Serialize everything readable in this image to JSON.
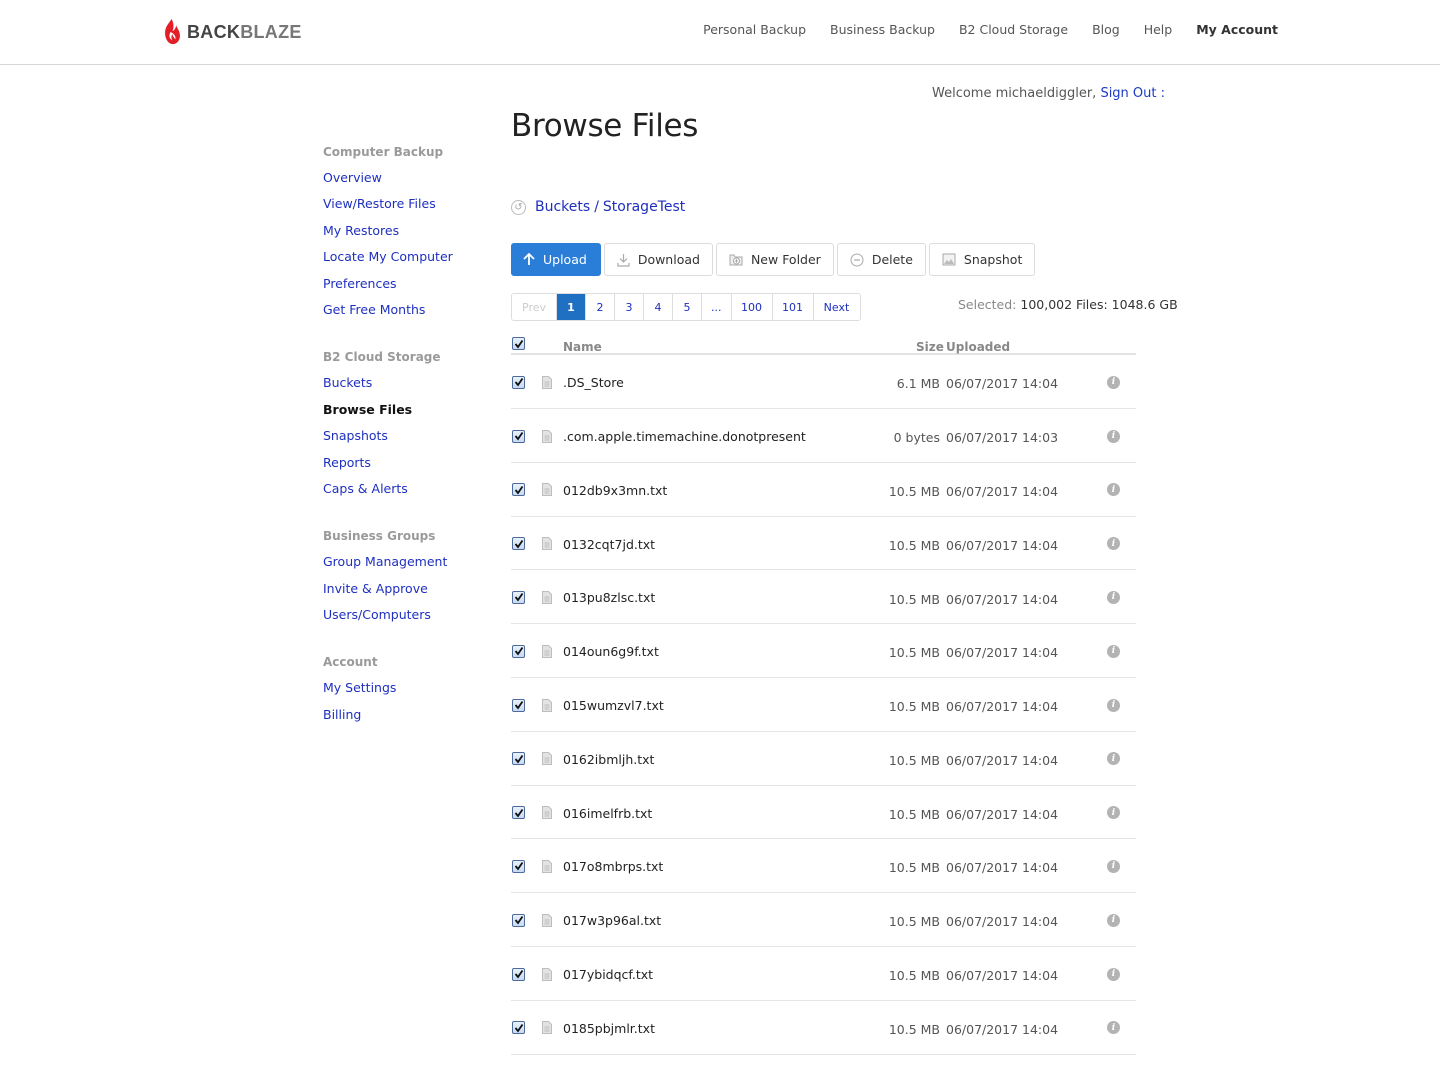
{
  "brand": {
    "name_part1": "BACK",
    "name_part2": "BLAZE",
    "accent": "#e21e26"
  },
  "topnav": [
    {
      "label": "Personal Backup",
      "bold": false
    },
    {
      "label": "Business Backup",
      "bold": false
    },
    {
      "label": "B2 Cloud Storage",
      "bold": false
    },
    {
      "label": "Blog",
      "bold": false
    },
    {
      "label": "Help",
      "bold": false
    },
    {
      "label": "My Account",
      "bold": true
    }
  ],
  "welcome": {
    "text": "Welcome michaeldiggler,",
    "signout": "Sign Out",
    "trailing": ":"
  },
  "sidebar": {
    "groups": [
      {
        "heading": "Computer Backup",
        "items": [
          {
            "label": "Overview"
          },
          {
            "label": "View/Restore Files"
          },
          {
            "label": "My Restores"
          },
          {
            "label": "Locate My Computer"
          },
          {
            "label": "Preferences"
          },
          {
            "label": "Get Free Months"
          }
        ]
      },
      {
        "heading": "B2 Cloud Storage",
        "items": [
          {
            "label": "Buckets"
          },
          {
            "label": "Browse Files",
            "active": true
          },
          {
            "label": "Snapshots"
          },
          {
            "label": "Reports"
          },
          {
            "label": "Caps & Alerts"
          }
        ]
      },
      {
        "heading": "Business Groups",
        "items": [
          {
            "label": "Group Management"
          },
          {
            "label": "Invite & Approve"
          },
          {
            "label": "Users/Computers"
          }
        ]
      },
      {
        "heading": "Account",
        "items": [
          {
            "label": "My Settings"
          },
          {
            "label": "Billing"
          }
        ]
      }
    ]
  },
  "page": {
    "title": "Browse Files",
    "breadcrumb": {
      "root": "Buckets",
      "separator": "/",
      "current": "StorageTest"
    },
    "toolbar": {
      "upload": "Upload",
      "download": "Download",
      "new_folder": "New Folder",
      "delete": "Delete",
      "snapshot": "Snapshot",
      "primary_color": "#2a7ed8"
    },
    "pagination": {
      "prev": "Prev",
      "next": "Next",
      "pages": [
        "1",
        "2",
        "3",
        "4",
        "5",
        "...",
        "100",
        "101"
      ],
      "current": "1"
    },
    "selected": {
      "label": "Selected:",
      "value": "100,002 Files: 1048.6 GB"
    },
    "table": {
      "header_checked": true,
      "columns": {
        "name": "Name",
        "size": "Size",
        "uploaded": "Uploaded"
      },
      "rows": [
        {
          "name": ".DS_Store",
          "size": "6.1 MB",
          "uploaded": "06/07/2017 14:04",
          "checked": true
        },
        {
          "name": ".com.apple.timemachine.donotpresent",
          "size": "0 bytes",
          "uploaded": "06/07/2017 14:03",
          "checked": true
        },
        {
          "name": "012db9x3mn.txt",
          "size": "10.5 MB",
          "uploaded": "06/07/2017 14:04",
          "checked": true
        },
        {
          "name": "0132cqt7jd.txt",
          "size": "10.5 MB",
          "uploaded": "06/07/2017 14:04",
          "checked": true
        },
        {
          "name": "013pu8zlsc.txt",
          "size": "10.5 MB",
          "uploaded": "06/07/2017 14:04",
          "checked": true
        },
        {
          "name": "014oun6g9f.txt",
          "size": "10.5 MB",
          "uploaded": "06/07/2017 14:04",
          "checked": true
        },
        {
          "name": "015wumzvl7.txt",
          "size": "10.5 MB",
          "uploaded": "06/07/2017 14:04",
          "checked": true
        },
        {
          "name": "0162ibmljh.txt",
          "size": "10.5 MB",
          "uploaded": "06/07/2017 14:04",
          "checked": true
        },
        {
          "name": "016imelfrb.txt",
          "size": "10.5 MB",
          "uploaded": "06/07/2017 14:04",
          "checked": true
        },
        {
          "name": "017o8mbrps.txt",
          "size": "10.5 MB",
          "uploaded": "06/07/2017 14:04",
          "checked": true
        },
        {
          "name": "017w3p96al.txt",
          "size": "10.5 MB",
          "uploaded": "06/07/2017 14:04",
          "checked": true
        },
        {
          "name": "017ybidqcf.txt",
          "size": "10.5 MB",
          "uploaded": "06/07/2017 14:04",
          "checked": true
        },
        {
          "name": "0185pbjmlr.txt",
          "size": "10.5 MB",
          "uploaded": "06/07/2017 14:04",
          "checked": true
        }
      ]
    }
  }
}
